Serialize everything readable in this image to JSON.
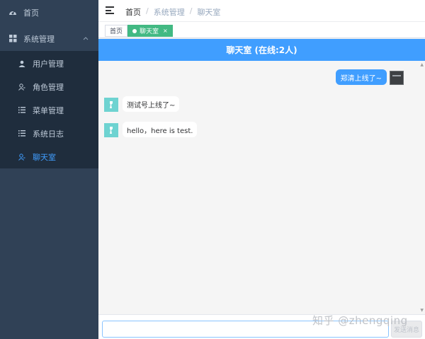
{
  "sidebar": {
    "home_label": "首页",
    "system_label": "系统管理",
    "items": [
      {
        "label": "用户管理",
        "icon": "user-icon"
      },
      {
        "label": "角色管理",
        "icon": "role-icon"
      },
      {
        "label": "菜单管理",
        "icon": "list-icon"
      },
      {
        "label": "系统日志",
        "icon": "log-icon"
      },
      {
        "label": "聊天室",
        "icon": "chat-icon"
      }
    ],
    "active_item": "聊天室"
  },
  "breadcrumb": {
    "home": "首页",
    "level1": "系统管理",
    "level2": "聊天室",
    "separator": "/"
  },
  "tags": {
    "home": "首页",
    "active": "聊天室",
    "close_glyph": "×"
  },
  "chat": {
    "header": "聊天室 (在线:2人)",
    "messages": [
      {
        "side": "right",
        "text": "郑清上线了~"
      },
      {
        "side": "left",
        "text": "测试号上线了~"
      },
      {
        "side": "left",
        "text": "hello，here is test."
      }
    ],
    "input_value": "",
    "send_label": "发送消息"
  },
  "watermark": "知乎 @zhengqing",
  "colors": {
    "sidebar_bg": "#304156",
    "submenu_bg": "#1f2d3d",
    "active": "#409eff",
    "tag_active": "#42b983",
    "header_bg": "#409eff"
  }
}
